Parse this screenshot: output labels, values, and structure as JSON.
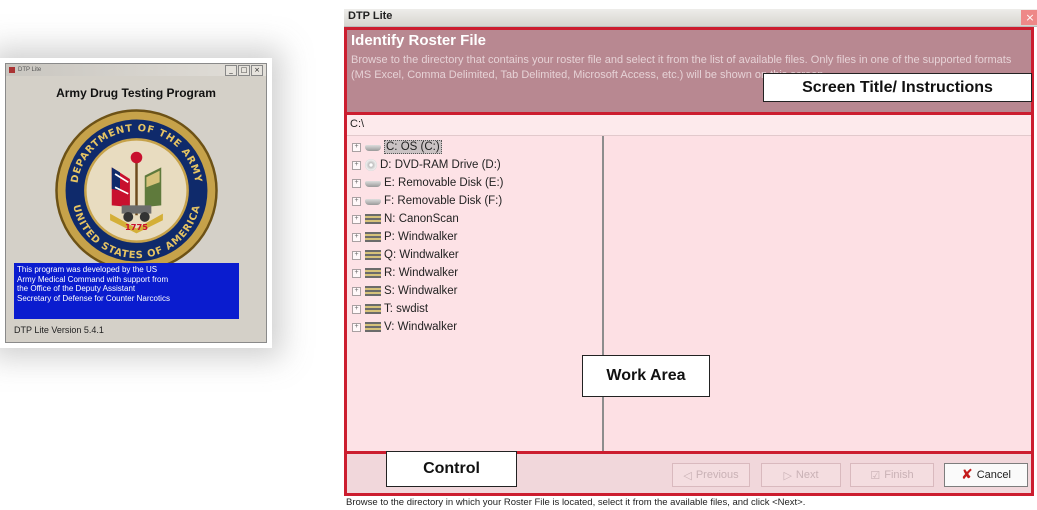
{
  "splash": {
    "window_title": "DTP Lite",
    "min_btn": "_",
    "max_btn": "□",
    "close_btn": "×",
    "heading": "Army Drug Testing Program",
    "seal": {
      "ring_text_top": "DEPARTMENT OF THE ARMY",
      "ring_text_bottom": "UNITED STATES OF AMERICA",
      "year": "1775"
    },
    "info_lines": [
      "This program was developed by the US",
      "Army Medical Command with support from",
      "the Office of the Deputy Assistant",
      "Secretary of Defense for Counter Narcotics"
    ],
    "version": "DTP Lite Version 5.4.1"
  },
  "window": {
    "title": "DTP Lite",
    "close_label": "×"
  },
  "header": {
    "title": "Identify Roster File",
    "instructions": "Browse to the directory that contains your roster file and select it from the list of available files. Only files in one of the supported formats (MS Excel, Comma Delimited, Tab Delimited, Microsoft Access, etc.) will be shown on this screen."
  },
  "path": "C:\\",
  "tree": [
    {
      "label": "C: OS (C:)",
      "icon": "hard-drive-icon",
      "selected": true
    },
    {
      "label": "D: DVD-RAM Drive (D:)",
      "icon": "dvd-drive-icon"
    },
    {
      "label": "E: Removable Disk (E:)",
      "icon": "removable-disk-icon"
    },
    {
      "label": "F: Removable Disk (F:)",
      "icon": "removable-disk-icon"
    },
    {
      "label": "N: CanonScan",
      "icon": "network-drive-icon"
    },
    {
      "label": "P: Windwalker",
      "icon": "network-drive-icon"
    },
    {
      "label": "Q: Windwalker",
      "icon": "network-drive-icon"
    },
    {
      "label": "R: Windwalker",
      "icon": "network-drive-icon"
    },
    {
      "label": "S: Windwalker",
      "icon": "network-drive-icon"
    },
    {
      "label": "T: swdist",
      "icon": "network-drive-icon"
    },
    {
      "label": "V: Windwalker",
      "icon": "network-drive-icon"
    }
  ],
  "expand_symbol": "+",
  "controls": {
    "previous": "Previous",
    "next": "Next",
    "finish": "Finish",
    "cancel": "Cancel",
    "cancel_icon": "✘",
    "previous_icon": "◁",
    "next_icon": "▷",
    "finish_icon": "☑"
  },
  "status_bar": "Browse to the directory in which your Roster File is located, select it from the available files, and click <Next>.",
  "callouts": {
    "screen_title": "Screen Title/ Instructions",
    "work_area": "Work Area",
    "control": "Control"
  },
  "colors": {
    "frame_red": "#cc1d2f",
    "header_bg": "#b88891",
    "work_bg": "#fde0e4",
    "splash_info_bg": "#0a1ccf"
  }
}
